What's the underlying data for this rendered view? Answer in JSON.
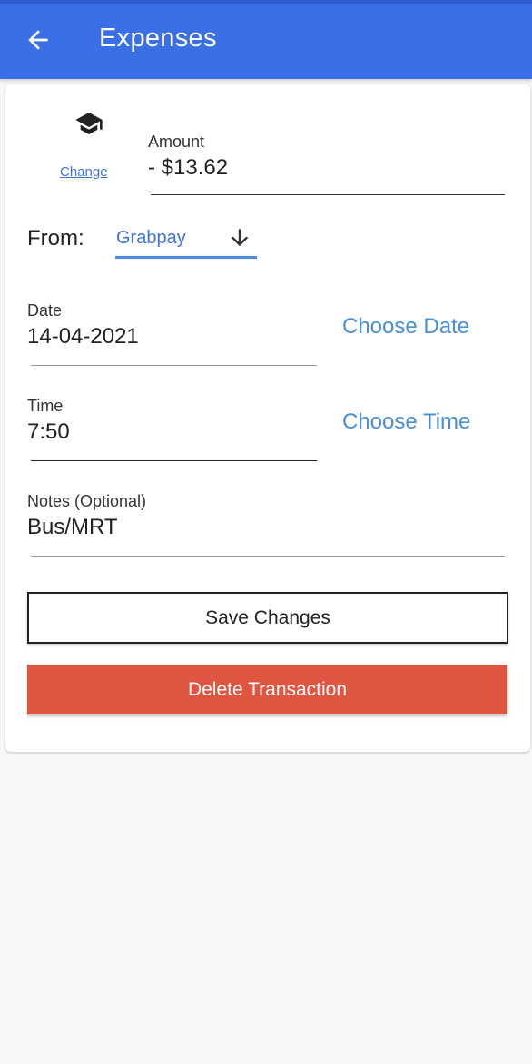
{
  "header": {
    "title": "Expenses",
    "back_icon": "arrow-left-icon"
  },
  "category": {
    "icon": "graduation-cap-icon",
    "change_label": "Change"
  },
  "amount": {
    "label": "Amount",
    "value": "- $13.62"
  },
  "from": {
    "label": "From:",
    "value": "Grabpay",
    "icon": "arrow-down-icon"
  },
  "date": {
    "label": "Date",
    "value": "14-04-2021",
    "choose_label": "Choose Date"
  },
  "time": {
    "label": "Time",
    "value": "7:50",
    "choose_label": "Choose Time"
  },
  "notes": {
    "label": "Notes (Optional)",
    "value": "Bus/MRT"
  },
  "actions": {
    "save_label": "Save Changes",
    "delete_label": "Delete Transaction"
  },
  "colors": {
    "appbar": "#3b6fe6",
    "link": "#4a8fd6",
    "delete": "#e05442",
    "background": "#f8f8f8"
  }
}
